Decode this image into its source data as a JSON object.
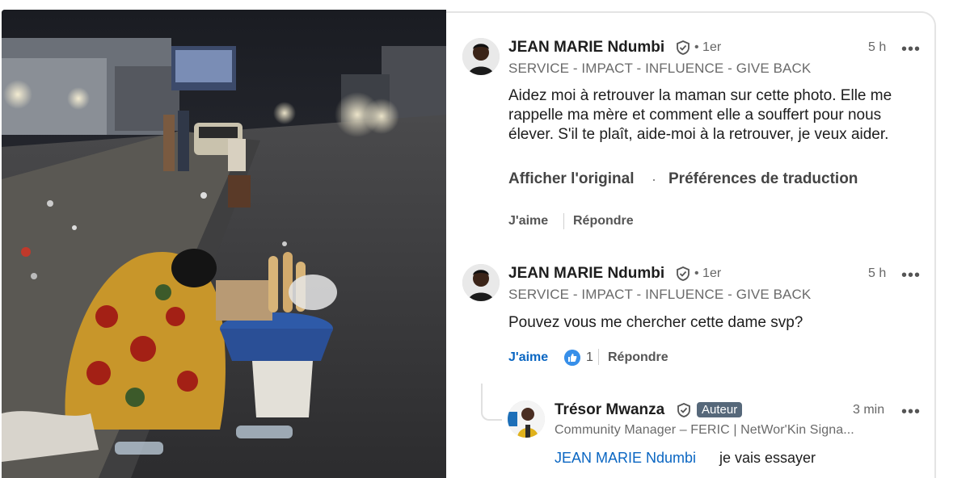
{
  "photo": {
    "icon": "street-scene-photo"
  },
  "comments": [
    {
      "author": "JEAN MARIE Ndumbi",
      "degree": "• 1er",
      "time": "5 h",
      "headline": "SERVICE - IMPACT - INFLUENCE - GIVE BACK",
      "text": "Aidez moi à retrouver la maman sur cette photo. Elle me rappelle ma mère et comment elle a souffert pour nous élever. S'il te plaît, aide-moi à la retrouver, je veux aider.",
      "show_original": "Afficher l'original",
      "separator": "·",
      "translation_prefs": "Préférences de traduction",
      "like": "J'aime",
      "reply": "Répondre"
    },
    {
      "author": "JEAN MARIE Ndumbi",
      "degree": "• 1er",
      "time": "5 h",
      "headline": "SERVICE - IMPACT - INFLUENCE - GIVE BACK",
      "text": "Pouvez vous me chercher cette dame svp?",
      "like": "J'aime",
      "reaction_count": "1",
      "reply": "Répondre"
    }
  ],
  "reply": {
    "author": "Trésor Mwanza",
    "badge": "Auteur",
    "time": "3 min",
    "headline": "Community Manager – FERIC | NetWor'Kin Signa...",
    "mention": "JEAN MARIE Ndumbi",
    "text": "je vais essayer"
  },
  "more_label": "•••",
  "colors": {
    "link_blue": "#0a66c2",
    "badge_bg": "#56687a",
    "reaction_blue": "#378fe9"
  }
}
